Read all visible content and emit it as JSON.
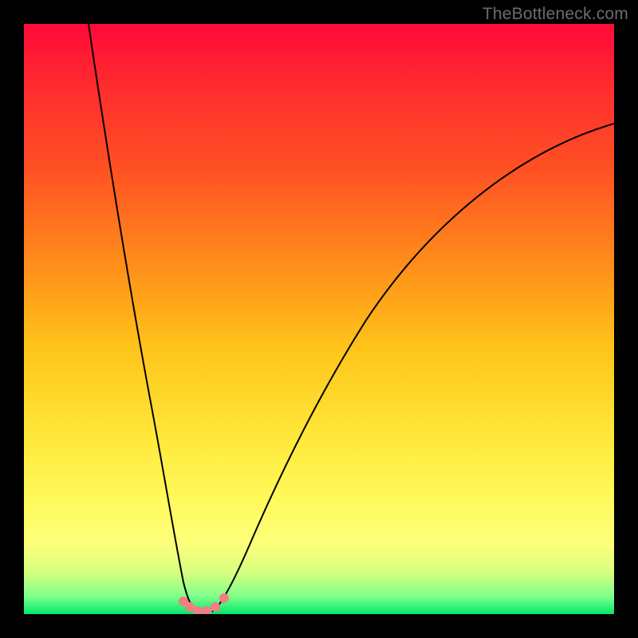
{
  "watermark": "TheBottleneck.com",
  "chart_data": {
    "type": "line",
    "title": "",
    "xlabel": "",
    "ylabel": "",
    "xlim": [
      0,
      100
    ],
    "ylim": [
      0,
      100
    ],
    "grid": false,
    "legend": false,
    "series": [
      {
        "name": "left-branch",
        "x": [
          11,
          14,
          17,
          20,
          22,
          24,
          25.5,
          27,
          28,
          29
        ],
        "y": [
          100,
          75,
          52,
          32,
          20,
          10,
          5,
          2,
          0.8,
          0.3
        ]
      },
      {
        "name": "right-branch",
        "x": [
          32,
          33,
          35,
          38,
          42,
          48,
          56,
          66,
          78,
          92,
          100
        ],
        "y": [
          0.3,
          1,
          3,
          8,
          16,
          28,
          42,
          56,
          68,
          78,
          83
        ]
      }
    ],
    "markers": [
      {
        "x": 27.0,
        "y": 2.0
      },
      {
        "x": 28.0,
        "y": 1.0
      },
      {
        "x": 29.5,
        "y": 0.4
      },
      {
        "x": 31.0,
        "y": 0.4
      },
      {
        "x": 32.5,
        "y": 1.0
      },
      {
        "x": 34.0,
        "y": 2.5
      }
    ],
    "gradient_stops": [
      {
        "pos": 0,
        "color": "#ff0a3a"
      },
      {
        "pos": 25,
        "color": "#ff5223"
      },
      {
        "pos": 55,
        "color": "#ffc41a"
      },
      {
        "pos": 80,
        "color": "#fff95a"
      },
      {
        "pos": 100,
        "color": "#00e86b"
      }
    ]
  }
}
